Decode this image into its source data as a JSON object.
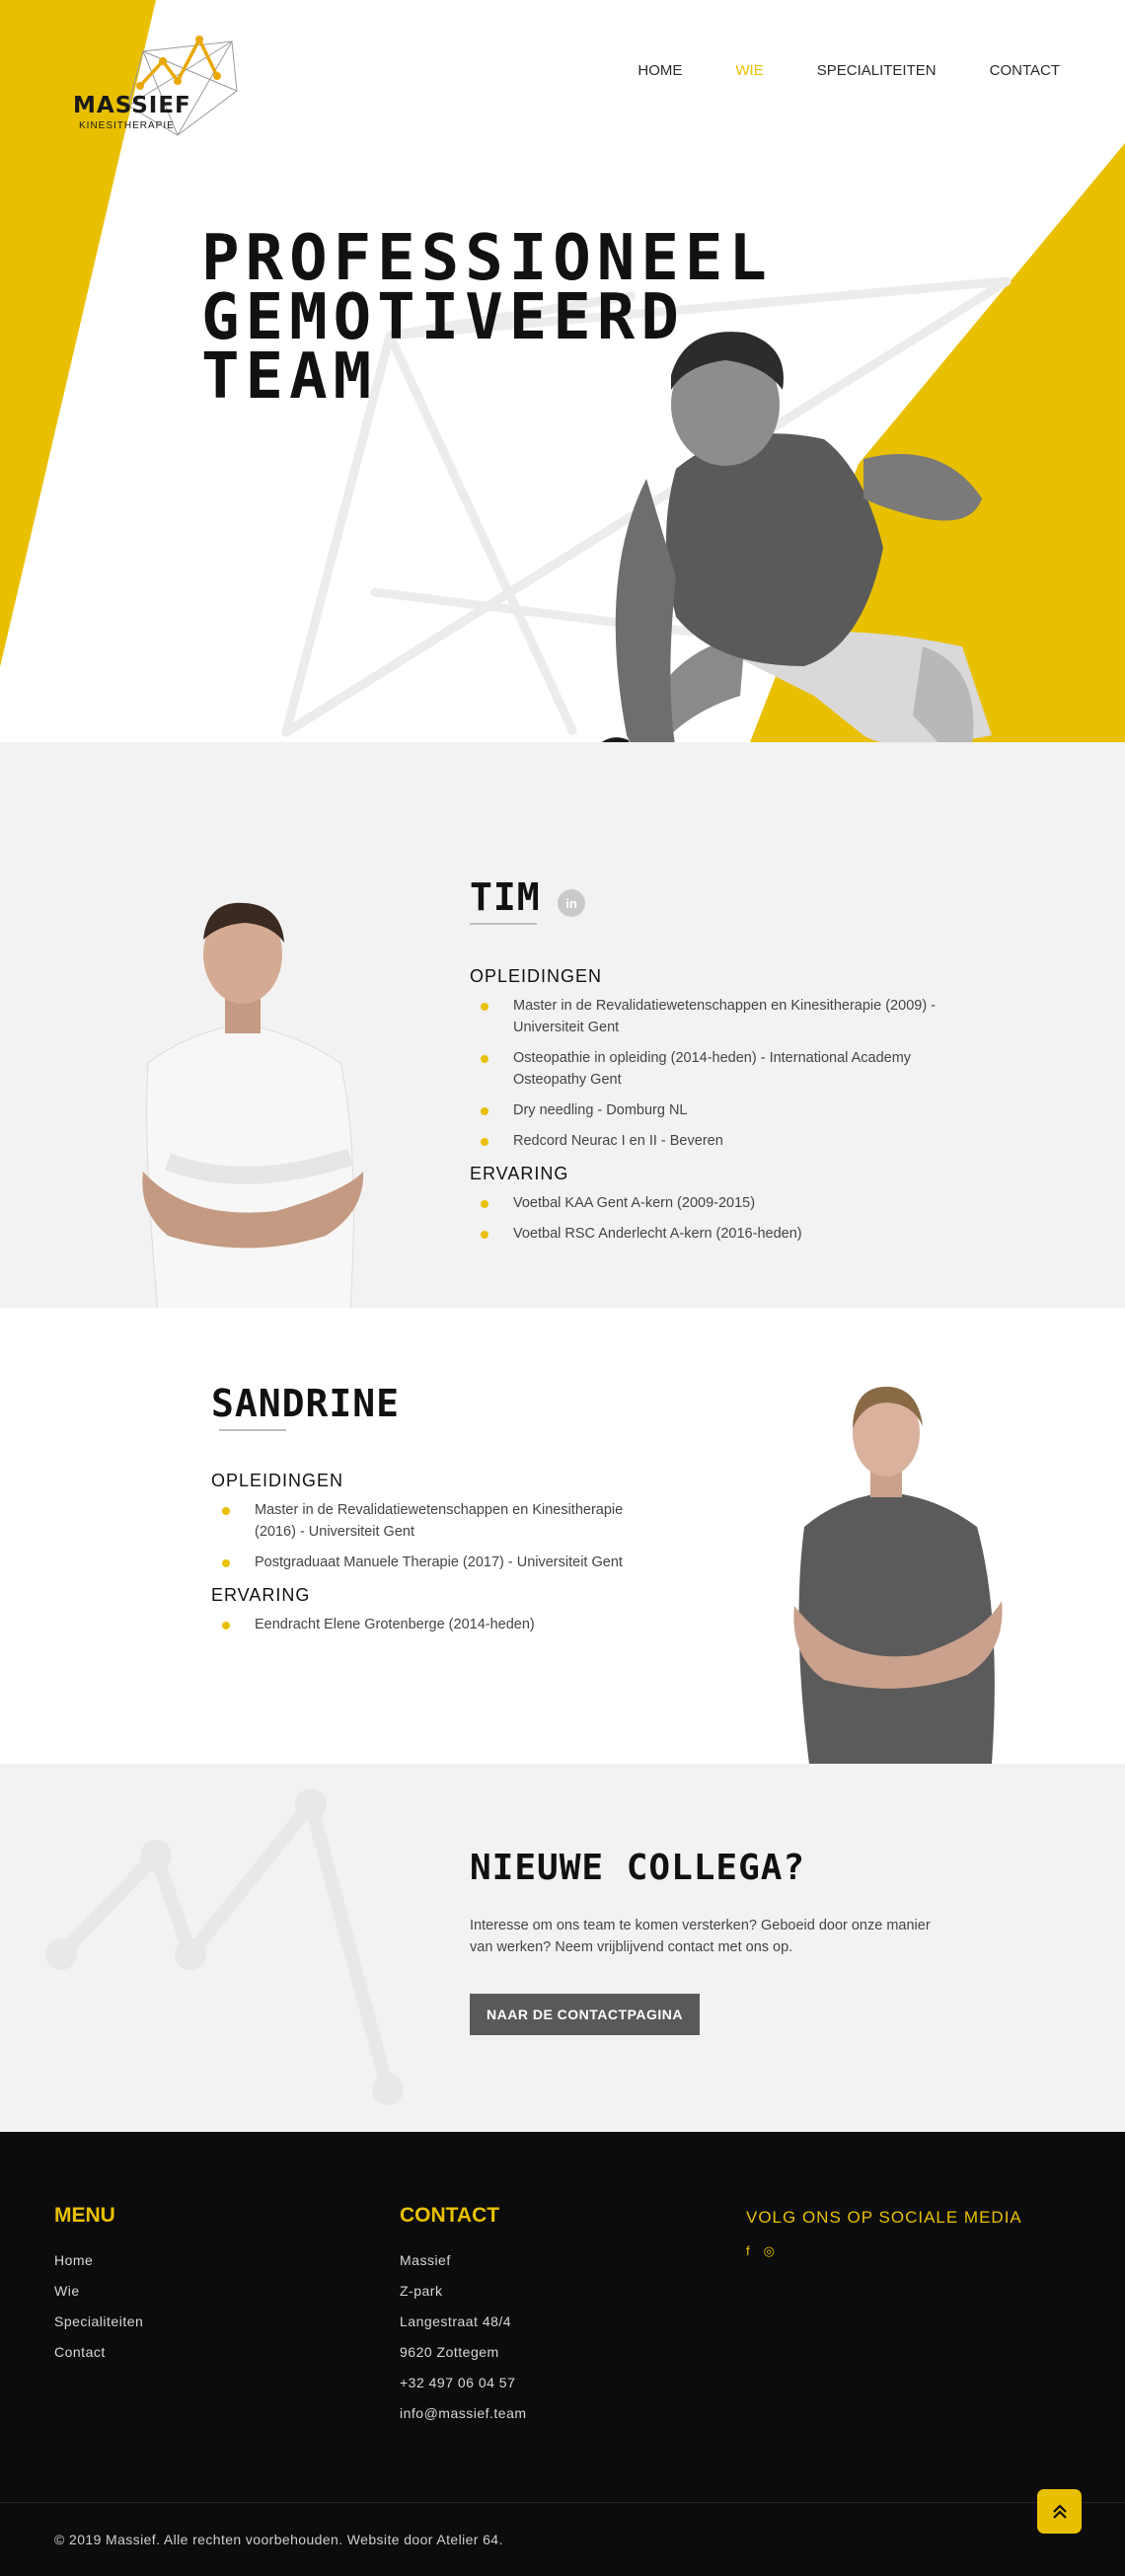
{
  "brand": {
    "name": "MASSIEF",
    "tagline": "KINESITHERAPIE",
    "accent": "#e8c000",
    "dark": "#0c0c0c",
    "light_gray": "#f2f2f2"
  },
  "nav": {
    "items": [
      {
        "label": "HOME",
        "active": false
      },
      {
        "label": "WIE",
        "active": true
      },
      {
        "label": "SPECIALITEITEN",
        "active": false
      },
      {
        "label": "CONTACT",
        "active": false
      }
    ]
  },
  "hero": {
    "title_lines": [
      "PROFESSIONEEL",
      "GEMOTIVEERD",
      "TEAM"
    ]
  },
  "tim": {
    "name": "TIM",
    "social_icon": "linkedin-icon",
    "social_label": "in",
    "education_heading": "OPLEIDINGEN",
    "education": [
      "Master in de Revalidatiewetenschappen en Kinesitherapie (2009) - Universiteit Gent",
      "Osteopathie in opleiding (2014-heden) - International Academy Osteopathy Gent",
      "Dry needling - Domburg NL",
      "Redcord Neurac I en II - Beveren"
    ],
    "experience_heading": "ERVARING",
    "experience": [
      "Voetbal KAA Gent A-kern (2009-2015)",
      "Voetbal RSC Anderlecht A-kern (2016-heden)"
    ]
  },
  "sandrine": {
    "name": "SANDRINE",
    "education_heading": "OPLEIDINGEN",
    "education": [
      "Master in de Revalidatiewetenschappen en Kinesitherapie (2016) - Universiteit Gent",
      "Postgraduaat Manuele Therapie (2017) - Universiteit Gent"
    ],
    "experience_heading": "ERVARING",
    "experience": [
      "Eendracht Elene Grotenberge (2014-heden)"
    ]
  },
  "collega": {
    "title": "NIEUWE COLLEGA?",
    "text": "Interesse om ons team te komen versterken? Geboeid door onze manier van werken? Neem vrijblijvend contact met ons op.",
    "button": "NAAR DE CONTACTPAGINA"
  },
  "footer": {
    "menu_heading": "MENU",
    "menu": [
      "Home",
      "Wie",
      "Specialiteiten",
      "Contact"
    ],
    "contact_heading": "CONTACT",
    "contact": [
      "Massief",
      "Z-park",
      "Langestraat 48/4",
      "9620 Zottegem",
      "+32 497 06 04 57",
      "info@massief.team"
    ],
    "social_heading": "VOLG ONS OP SOCIALE MEDIA",
    "social_icons": [
      {
        "name": "facebook-icon",
        "glyph": "f"
      },
      {
        "name": "instagram-icon",
        "glyph": "◎"
      }
    ],
    "copyright": "© 2019 Massief. Alle rechten voorbehouden. Website door Atelier 64.",
    "to_top_icon": "double-chevron-up-icon"
  }
}
